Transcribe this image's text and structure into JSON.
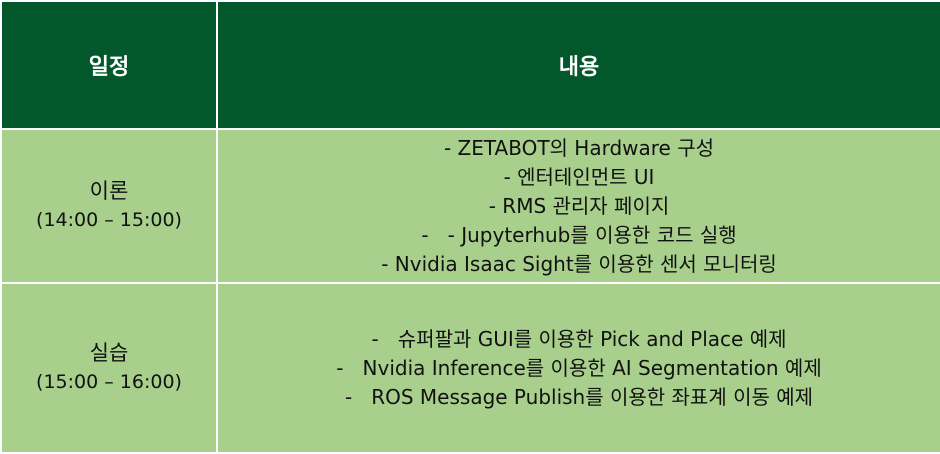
{
  "header": {
    "col_schedule": "일정",
    "col_content": "내용"
  },
  "rows": [
    {
      "name": "이론",
      "time": "(14:00 – 15:00)",
      "items": [
        "- ZETABOT의 Hardware 구성",
        "- 엔터테인먼트 UI",
        "- RMS 관리자 페이지",
        "-   - Jupyterhub를 이용한 코드 실행",
        "- Nvidia Isaac Sight를 이용한 센서 모니터링"
      ]
    },
    {
      "name": "실습",
      "time": "(15:00 – 16:00)",
      "items": [
        "-   슈퍼팔과 GUI를 이용한 Pick and Place 예제",
        "-   Nvidia Inference를 이용한 AI Segmentation 예제",
        "-   ROS Message Publish를 이용한 좌표계 이동 예제"
      ]
    }
  ]
}
